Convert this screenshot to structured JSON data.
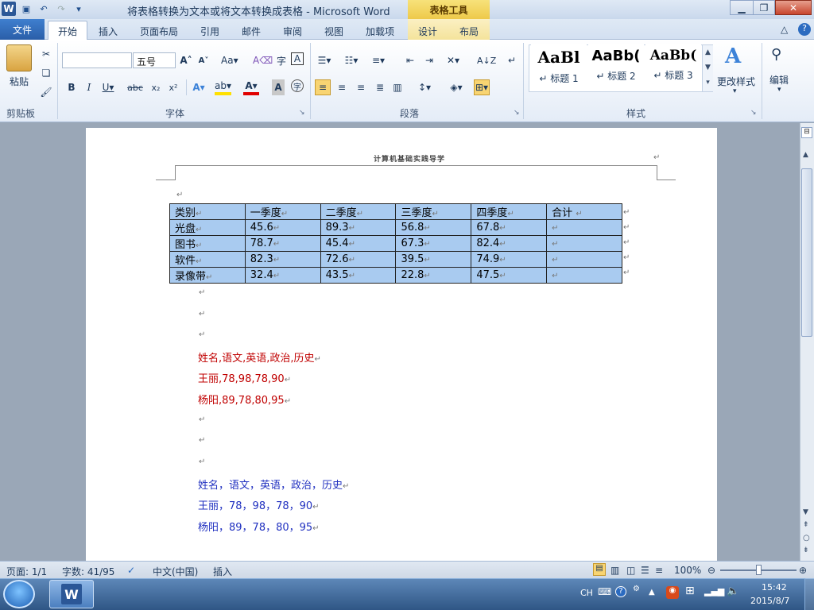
{
  "titlebar": {
    "title": "将表格转换为文本或将文本转换成表格 - Microsoft Word",
    "context_tab": "表格工具"
  },
  "tabs": [
    "文件",
    "开始",
    "插入",
    "页面布局",
    "引用",
    "邮件",
    "审阅",
    "视图",
    "加载项",
    "设计",
    "布局"
  ],
  "ribbon": {
    "clipboard": {
      "paste": "粘贴",
      "label": "剪贴板"
    },
    "font": {
      "font_name": "",
      "font_size": "五号",
      "label": "字体"
    },
    "paragraph": {
      "label": "段落"
    },
    "styles": {
      "items": [
        {
          "preview": "AaBl",
          "name": "↵ 标题 1"
        },
        {
          "preview": "AaBb(",
          "name": "↵ 标题 2"
        },
        {
          "preview": "AaBb(",
          "name": "↵ 标题 3"
        }
      ],
      "change": "更改样式",
      "label": "样式"
    },
    "editing": {
      "label": "编辑"
    }
  },
  "document": {
    "header_text": "计算机基础实践导学",
    "table": {
      "headers": [
        "类别",
        "一季度",
        "二季度",
        "三季度",
        "四季度",
        "合计"
      ],
      "rows": [
        [
          "光盘",
          "45.6",
          "89.3",
          "56.8",
          "67.8",
          ""
        ],
        [
          "图书",
          "78.7",
          "45.4",
          "67.3",
          "82.4",
          ""
        ],
        [
          "软件",
          "82.3",
          "72.6",
          "39.5",
          "74.9",
          ""
        ],
        [
          "录像带",
          "32.4",
          "43.5",
          "22.8",
          "47.5",
          ""
        ]
      ]
    },
    "red_lines": [
      "姓名,语文,英语,政治,历史",
      "王丽,78,98,78,90",
      "杨阳,89,78,80,95"
    ],
    "blue_lines": [
      "姓名，语文，英语，政治，历史",
      "王丽，78，98，78，90",
      "杨阳，89，78，80，95"
    ],
    "para_mark": "↵"
  },
  "status": {
    "page": "页面: 1/1",
    "words": "字数: 41/95",
    "lang": "中文(中国)",
    "mode": "插入",
    "zoom": "100%"
  },
  "taskbar": {
    "ime": "CH",
    "time": "15:42",
    "date": "2015/8/7"
  },
  "colors": {
    "accent": "#2b5797",
    "table_fill": "#a9cbf0",
    "red_text": "#c00000",
    "blue_text": "#2030c0"
  }
}
